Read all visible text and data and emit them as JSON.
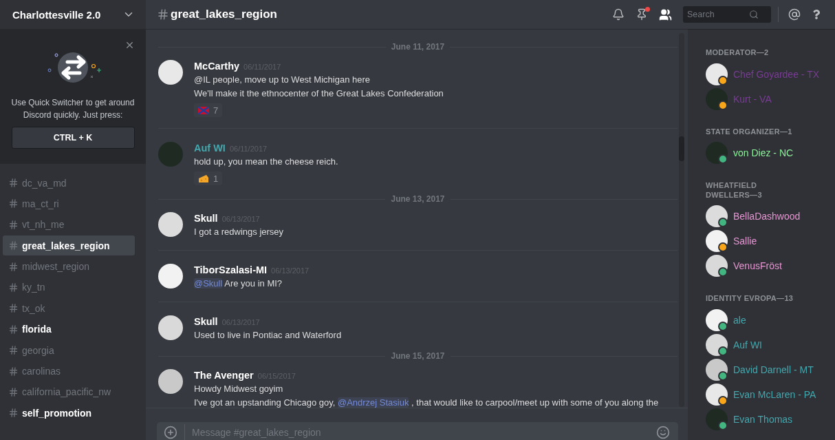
{
  "server": {
    "name": "Charlottesville 2.0"
  },
  "quick_switcher": {
    "text": "Use Quick Switcher to get around Discord quickly. Just press:",
    "shortcut": "CTRL + K"
  },
  "channels": [
    {
      "name": "dc_va_md",
      "selected": false,
      "unread": false
    },
    {
      "name": "ma_ct_ri",
      "selected": false,
      "unread": false
    },
    {
      "name": "vt_nh_me",
      "selected": false,
      "unread": false
    },
    {
      "name": "great_lakes_region",
      "selected": true,
      "unread": true
    },
    {
      "name": "midwest_region",
      "selected": false,
      "unread": false
    },
    {
      "name": "ky_tn",
      "selected": false,
      "unread": false
    },
    {
      "name": "tx_ok",
      "selected": false,
      "unread": false
    },
    {
      "name": "florida",
      "selected": false,
      "unread": true
    },
    {
      "name": "georgia",
      "selected": false,
      "unread": false
    },
    {
      "name": "carolinas",
      "selected": false,
      "unread": false
    },
    {
      "name": "california_pacific_nw",
      "selected": false,
      "unread": false
    },
    {
      "name": "self_promotion",
      "selected": false,
      "unread": true
    }
  ],
  "channel_header": {
    "name": "great_lakes_region",
    "pins_badge": true
  },
  "search": {
    "placeholder": "Search"
  },
  "messages": [
    {
      "kind": "date",
      "text": "June 11, 2017"
    },
    {
      "kind": "message",
      "author": "McCarthy",
      "color": "#ffffff",
      "time": "06/11/2017",
      "lines": [
        [
          {
            "kind": "text",
            "text": "@IL people, move up to West Michigan here"
          }
        ],
        [
          {
            "kind": "text",
            "text": "We'll make it the ethnocenter of the Great Lakes Confederation"
          }
        ]
      ],
      "reactions": [
        {
          "kind": "flag",
          "count": "7"
        }
      ]
    },
    {
      "kind": "message",
      "author": "Auf WI",
      "color": "#43a8ae",
      "time": "06/11/2017",
      "lines": [
        [
          {
            "kind": "text",
            "text": "hold up, you mean the cheese reich."
          }
        ]
      ],
      "reactions": [
        {
          "kind": "cheese",
          "count": "1"
        }
      ]
    },
    {
      "kind": "date",
      "text": "June 13, 2017"
    },
    {
      "kind": "message",
      "author": "Skull",
      "color": "#ffffff",
      "time": "06/13/2017",
      "lines": [
        [
          {
            "kind": "text",
            "text": "I got a redwings jersey"
          }
        ]
      ]
    },
    {
      "kind": "message",
      "author": "TiborSzalasi-MI",
      "color": "#ffffff",
      "time": "06/13/2017",
      "lines": [
        [
          {
            "kind": "mention",
            "text": "@Skull"
          },
          {
            "kind": "text",
            "text": " Are you in MI?"
          }
        ]
      ]
    },
    {
      "kind": "message",
      "author": "Skull",
      "color": "#ffffff",
      "time": "06/13/2017",
      "lines": [
        [
          {
            "kind": "text",
            "text": "Used to live in Pontiac and Waterford"
          }
        ]
      ]
    },
    {
      "kind": "date",
      "text": "June 15, 2017"
    },
    {
      "kind": "message",
      "author": "The Avenger",
      "color": "#ffffff",
      "time": "06/15/2017",
      "lines": [
        [
          {
            "kind": "text",
            "text": "Howdy Midwest goyim"
          }
        ],
        [
          {
            "kind": "text",
            "text": "I've got an upstanding Chicago goy, "
          },
          {
            "kind": "mention",
            "text": "@Andrzej Stasiuk"
          },
          {
            "kind": "text",
            "text": " , that would like to carpool/meet up with some of you along the"
          }
        ]
      ]
    }
  ],
  "composer": {
    "placeholder": "Message #great_lakes_region"
  },
  "member_groups": [
    {
      "title": "MODERATOR—2",
      "members": [
        {
          "name": "Chef Goyardee - TX",
          "color": "#7a3b96",
          "idle": true
        },
        {
          "name": "Kurt - VA",
          "color": "#7a3b96",
          "idle": true
        }
      ]
    },
    {
      "title": "STATE ORGANIZER—1",
      "members": [
        {
          "name": "von Diez - NC",
          "color": "#8cf29a",
          "idle": false
        }
      ]
    },
    {
      "title": "WHEATFIELD DWELLERS—3",
      "members": [
        {
          "name": "BellaDashwood",
          "color": "#e795d3",
          "idle": false
        },
        {
          "name": "Sallie",
          "color": "#e795d3",
          "idle": true
        },
        {
          "name": "VenusFröst",
          "color": "#e795d3",
          "idle": false
        }
      ]
    },
    {
      "title": "IDENTITY EVROPA—13",
      "members": [
        {
          "name": "ale",
          "color": "#43a8ae",
          "idle": false
        },
        {
          "name": "Auf WI",
          "color": "#43a8ae",
          "idle": false
        },
        {
          "name": "David Darnell - MT",
          "color": "#43a8ae",
          "idle": false
        },
        {
          "name": "Evan McLaren - PA",
          "color": "#43a8ae",
          "idle": true
        },
        {
          "name": "Evan Thomas",
          "color": "#43a8ae",
          "idle": false
        }
      ]
    }
  ]
}
